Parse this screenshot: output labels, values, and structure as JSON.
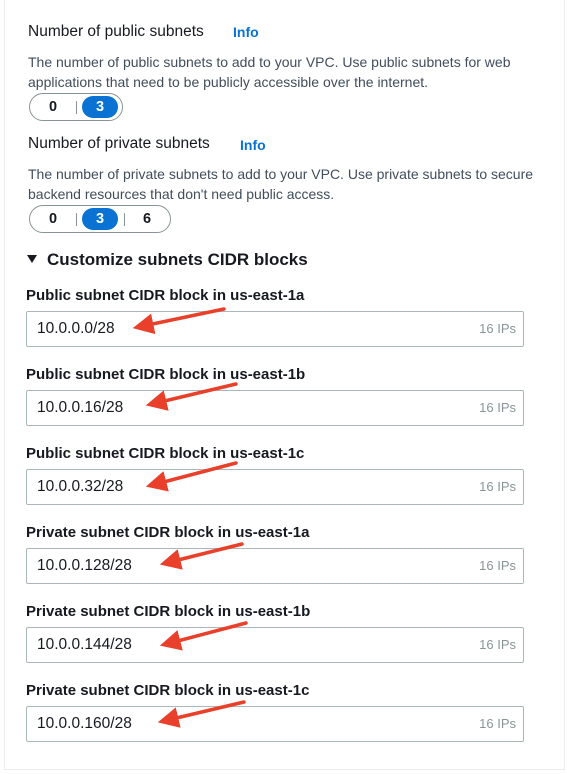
{
  "public_subnets": {
    "label": "Number of public subnets",
    "info": "Info",
    "description": "The number of public subnets to add to your VPC. Use public subnets for web applications that need to be publicly accessible over the internet.",
    "options": [
      "0",
      "3"
    ],
    "selected": "3"
  },
  "private_subnets": {
    "label": "Number of private subnets",
    "info": "Info",
    "description": "The number of private subnets to add to your VPC. Use private subnets to secure backend resources that don't need public access.",
    "options": [
      "0",
      "3",
      "6"
    ],
    "selected": "3"
  },
  "customize": {
    "label": "Customize subnets CIDR blocks",
    "expanded": true
  },
  "cidr_fields": [
    {
      "label": "Public subnet CIDR block in us-east-1a",
      "value": "10.0.0.0/28",
      "suffix": "16 IPs"
    },
    {
      "label": "Public subnet CIDR block in us-east-1b",
      "value": "10.0.0.16/28",
      "suffix": "16 IPs"
    },
    {
      "label": "Public subnet CIDR block in us-east-1c",
      "value": "10.0.0.32/28",
      "suffix": "16 IPs"
    },
    {
      "label": "Private subnet CIDR block in us-east-1a",
      "value": "10.0.0.128/28",
      "suffix": "16 IPs"
    },
    {
      "label": "Private subnet CIDR block in us-east-1b",
      "value": "10.0.0.144/28",
      "suffix": "16 IPs"
    },
    {
      "label": "Private subnet CIDR block in us-east-1c",
      "value": "10.0.0.160/28",
      "suffix": "16 IPs"
    }
  ],
  "colors": {
    "accent": "#0972d3",
    "annotation_arrow": "#e8402a"
  }
}
